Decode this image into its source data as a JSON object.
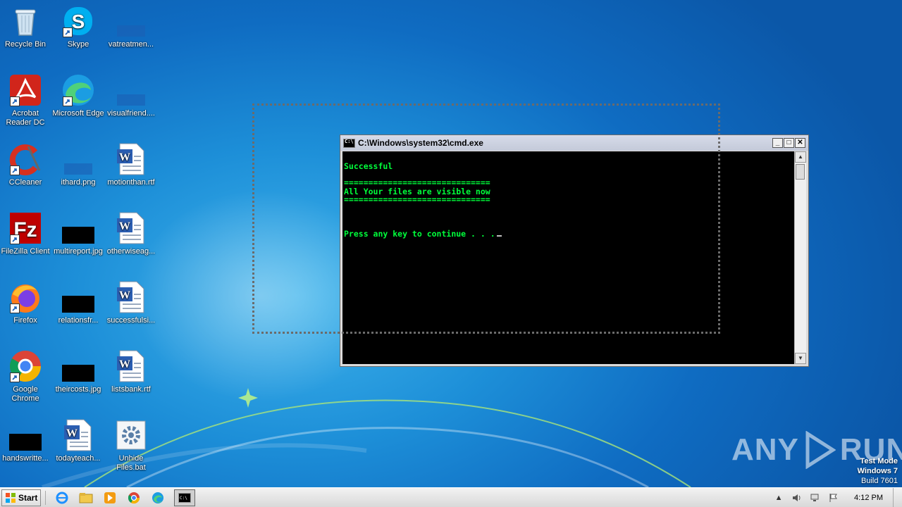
{
  "desktop": {
    "icons": [
      {
        "label": "Recycle Bin"
      },
      {
        "label": "Skype"
      },
      {
        "label": "vatreatmen..."
      },
      {
        "label": "Acrobat Reader DC"
      },
      {
        "label": "Microsoft Edge"
      },
      {
        "label": "visualfriend...."
      },
      {
        "label": "CCleaner"
      },
      {
        "label": "ithard.png"
      },
      {
        "label": "motionthan.rtf"
      },
      {
        "label": "FileZilla Client"
      },
      {
        "label": "multireport.jpg"
      },
      {
        "label": "otherwiseag..."
      },
      {
        "label": "Firefox"
      },
      {
        "label": "relationsfr..."
      },
      {
        "label": "successfulsi..."
      },
      {
        "label": "Google Chrome"
      },
      {
        "label": "theircosts.jpg"
      },
      {
        "label": "listsbank.rtf"
      },
      {
        "label": "handswritte..."
      },
      {
        "label": "todayteach..."
      },
      {
        "label": "Unhide Files.bat"
      }
    ]
  },
  "cmd_window": {
    "title": "C:\\Windows\\system32\\cmd.exe",
    "buttons": {
      "minimize": "_",
      "maximize": "□",
      "close": "✕"
    },
    "lines": [
      "Successful",
      "==============================",
      "All Your files are visible now",
      "==============================",
      "Press any key to continue . . ."
    ],
    "text_color": "#00ff3b"
  },
  "watermark": {
    "brand_left": "ANY",
    "brand_right": "RUN",
    "test_mode": "Test Mode",
    "os": "Windows 7",
    "build": "Build 7601"
  },
  "taskbar": {
    "start_label": "Start",
    "pinned": [
      "ie-icon",
      "explorer-icon",
      "media-player-icon",
      "chrome-icon",
      "edge-icon",
      "cmd-icon"
    ],
    "clock": "4:12 PM"
  }
}
